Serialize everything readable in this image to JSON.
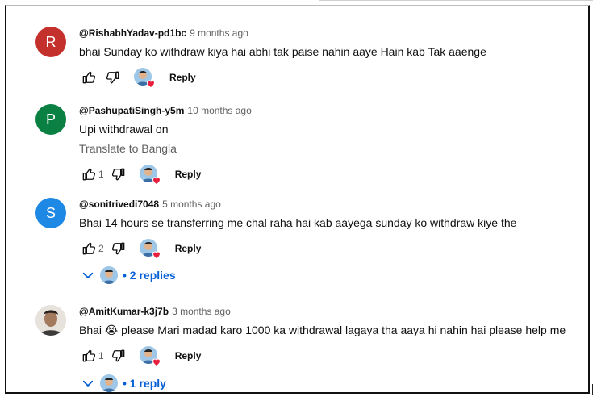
{
  "comments": [
    {
      "avatar_letter": "R",
      "avatar_color": "#c4302b",
      "handle": "@RishabhYadav-pd1bc",
      "time": "9 months ago",
      "text": "bhai Sunday ko withdraw kiya hai abhi tak paise nahin aaye Hain kab Tak aaenge",
      "likes": "",
      "reply_label": "Reply"
    },
    {
      "avatar_letter": "P",
      "avatar_color": "#0b8043",
      "handle": "@PashupatiSingh-y5m",
      "time": "10 months ago",
      "text": "Upi withdrawal on",
      "translate": "Translate to Bangla",
      "likes": "1",
      "reply_label": "Reply"
    },
    {
      "avatar_letter": "S",
      "avatar_color": "#1e88e5",
      "handle": "@sonitrivedi7048",
      "time": "5 months ago",
      "text": "Bhai 14 hours se transferring me chal raha hai kab aayega sunday ko withdraw kiye the",
      "likes": "2",
      "reply_label": "Reply",
      "replies_label": "• 2 replies"
    },
    {
      "handle": "@AmitKumar-k3j7b",
      "time": "3 months ago",
      "text": "Bhai 😭 please Mari madad karo 1000 ka withdrawal lagaya tha aaya hi nahin hai please help me",
      "likes": "1",
      "reply_label": "Reply",
      "replies_label": "• 1 reply"
    }
  ],
  "colors": {
    "link_blue": "#065fd4",
    "heart_red": "#e91e3c"
  },
  "icons": [
    "thumb-up-icon",
    "thumb-down-icon",
    "creator-heart-icon",
    "chevron-down-icon"
  ]
}
